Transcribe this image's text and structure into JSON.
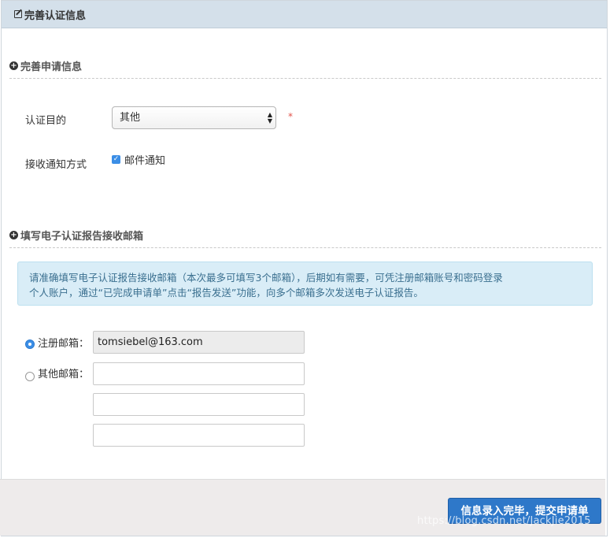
{
  "header": {
    "title": "完善认证信息",
    "icon": "edit-icon"
  },
  "section1": {
    "title": "完善申请信息",
    "icon": "plus-circle-icon"
  },
  "purpose": {
    "label": "认证目的",
    "selected": "其他",
    "required_mark": "*"
  },
  "notify": {
    "label": "接收通知方式",
    "option_label": "邮件通知",
    "checked": true
  },
  "section2": {
    "title": "填写电子认证报告接收邮箱",
    "icon": "plus-circle-icon"
  },
  "info": {
    "line1": "请准确填写电子认证报告接收邮箱（本次最多可填写3个邮箱），后期如有需要，可凭注册邮箱账号和密码登录",
    "line2": "个人账户，通过“已完成申请单”点击“报告发送”功能，向多个邮箱多次发送电子认证报告。"
  },
  "emails": {
    "registered_label": "注册邮箱：",
    "registered_value": "tomsiebel@163.com",
    "other_label": "其他邮箱：",
    "other_values": [
      "",
      "",
      ""
    ]
  },
  "footer": {
    "submit_label": "信息录入完毕，提交申请单"
  },
  "watermark": "https://blog.csdn.net/JackJie2015",
  "colors": {
    "accent": "#2e78c9",
    "header_bg": "#d4e0ea",
    "info_bg": "#d9edf7"
  }
}
